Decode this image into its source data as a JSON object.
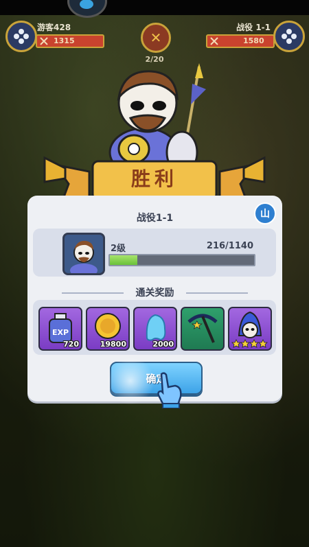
{
  "top": {
    "left_name": "游客428",
    "left_power": "1315",
    "right_name": "战役 1-1",
    "right_power": "1580",
    "round": "2/20"
  },
  "banner": {
    "title": "胜利"
  },
  "panel": {
    "title": "战役1-1",
    "level": "2级",
    "xp_text": "216/1140",
    "xp_fraction": 0.19,
    "reward_header": "通关奖励",
    "mountain_icon": "山",
    "rewards": [
      {
        "icon": "exp-potion-icon",
        "count": "720"
      },
      {
        "icon": "gold-coin-icon",
        "count": "19800"
      },
      {
        "icon": "blue-crystal-icon",
        "count": "2000"
      },
      {
        "icon": "pickaxe-icon",
        "stars": 1
      },
      {
        "icon": "wizard-hero-icon",
        "stars": 4
      }
    ],
    "confirm": "确定"
  },
  "colors": {
    "accent": "#3da3e8",
    "banner": "#f2c14a",
    "power_bar": "#c9432e"
  }
}
